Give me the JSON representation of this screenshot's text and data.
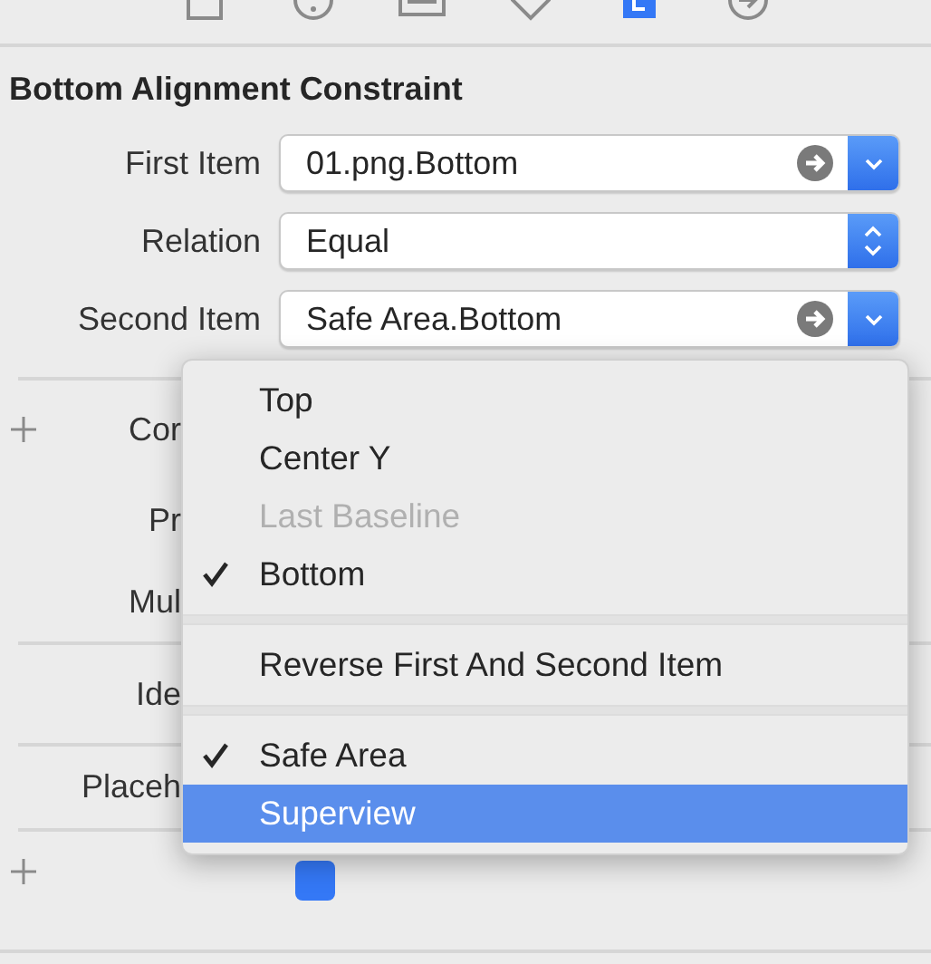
{
  "toolbar": [
    {
      "kind": "file",
      "selected": false
    },
    {
      "kind": "help",
      "selected": false
    },
    {
      "kind": "identity",
      "selected": false
    },
    {
      "kind": "attributes",
      "selected": false
    },
    {
      "kind": "size",
      "selected": true
    },
    {
      "kind": "connections",
      "selected": false
    }
  ],
  "section_title": "Bottom Alignment Constraint",
  "fields": [
    {
      "label": "First Item",
      "value": "01.png.Bottom",
      "kind": "pulldown",
      "go_arrow": true
    },
    {
      "label": "Relation",
      "value": "Equal",
      "kind": "popup",
      "go_arrow": false
    },
    {
      "label": "Second Item",
      "value": "Safe Area.Bottom",
      "kind": "pulldown",
      "go_arrow": true
    }
  ],
  "hidden_rows": [
    {
      "label": "Cor",
      "add": true,
      "divider_after": false
    },
    {
      "label": "Pr",
      "add": false,
      "divider_after": false
    },
    {
      "label": "Mul",
      "add": false,
      "divider_after": true
    },
    {
      "label": "Ide",
      "add": false,
      "divider_after": true
    },
    {
      "label": "Placeh",
      "add": false,
      "divider_after": true
    }
  ],
  "installed": {
    "checked": true
  },
  "menu": [
    {
      "kind": "item",
      "label": "Top",
      "checked": false,
      "disabled": false,
      "selected": false
    },
    {
      "kind": "item",
      "label": "Center Y",
      "checked": false,
      "disabled": false,
      "selected": false
    },
    {
      "kind": "item",
      "label": "Last Baseline",
      "checked": false,
      "disabled": true,
      "selected": false
    },
    {
      "kind": "item",
      "label": "Bottom",
      "checked": true,
      "disabled": false,
      "selected": false
    },
    {
      "kind": "separator"
    },
    {
      "kind": "item",
      "label": "Reverse First And Second Item",
      "checked": false,
      "disabled": false,
      "selected": false
    },
    {
      "kind": "separator"
    },
    {
      "kind": "item",
      "label": "Safe Area",
      "checked": true,
      "disabled": false,
      "selected": false
    },
    {
      "kind": "item",
      "label": "Superview",
      "checked": false,
      "disabled": false,
      "selected": true
    }
  ]
}
